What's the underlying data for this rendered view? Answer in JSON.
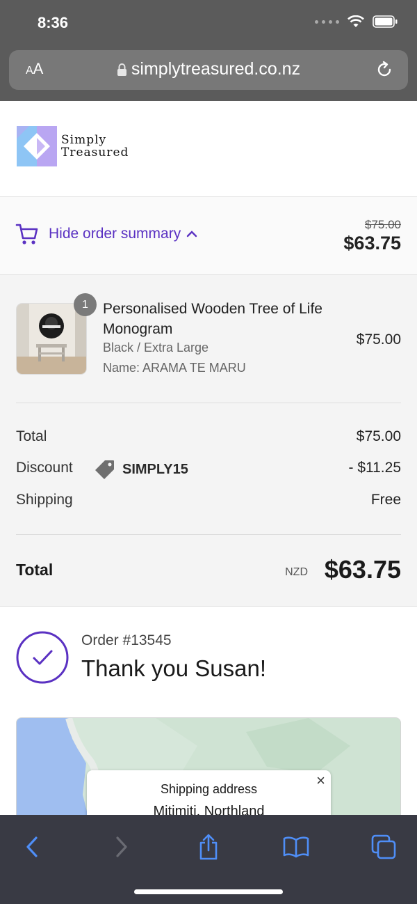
{
  "status": {
    "time": "8:36"
  },
  "browser": {
    "text_size_label_small": "A",
    "text_size_label_large": "A",
    "url": "simplytreasured.co.nz"
  },
  "brand": {
    "logo_line1": "Simply",
    "logo_line2": "Treasured",
    "colors": {
      "accent": "#5a31c2",
      "logo_blue": "#8ec5f5",
      "logo_purple": "#b9a6f2"
    }
  },
  "summary_toggle": {
    "label": "Hide order summary",
    "original_price": "$75.00",
    "price": "$63.75"
  },
  "line_item": {
    "quantity": "1",
    "title": "Personalised Wooden Tree of Life Monogram",
    "variant": "Black / Extra Large",
    "custom_name": "Name: ARAMA TE MARU",
    "price": "$75.00"
  },
  "totals": {
    "subtotal_label": "Total",
    "subtotal_value": "$75.00",
    "discount_label": "Discount",
    "discount_code": "SIMPLY15",
    "discount_value": "- $11.25",
    "shipping_label": "Shipping",
    "shipping_value": "Free",
    "total_label": "Total",
    "currency": "NZD",
    "total_value": "$63.75"
  },
  "confirmation": {
    "order_number": "Order #13545",
    "heading": "Thank you Susan!"
  },
  "map": {
    "popup_title": "Shipping address",
    "popup_address": "Mitimiti, Northland",
    "close_symbol": "×"
  },
  "icons": [
    "lock-icon",
    "reload-icon",
    "cart-icon",
    "chevron-up-icon",
    "tag-icon",
    "checkmark-icon",
    "back-icon",
    "forward-icon",
    "share-icon",
    "bookmarks-icon",
    "tabs-icon"
  ]
}
